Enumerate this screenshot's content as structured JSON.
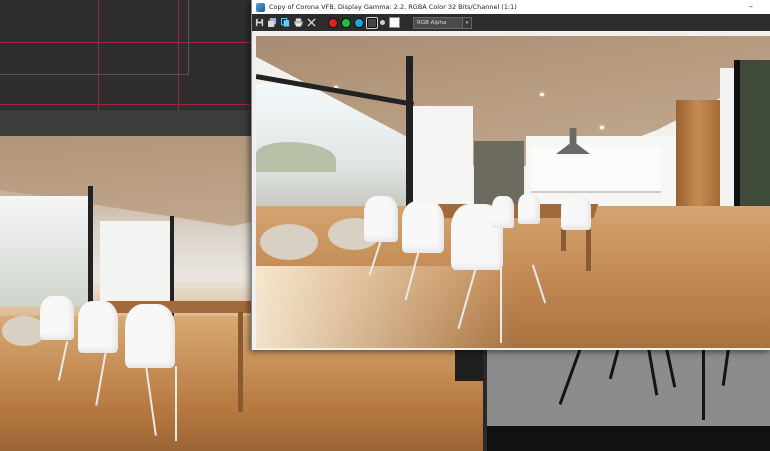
{
  "vfb": {
    "title": "Copy of Corona VFB, Display Gamma: 2.2, RGBA Color 32 Bits/Channel (1:1)",
    "minimize_glyph": "–",
    "toolbar": {
      "buttons": [
        {
          "name": "save-icon"
        },
        {
          "name": "save-all-icon"
        },
        {
          "name": "copy-icon"
        },
        {
          "name": "print-icon"
        },
        {
          "name": "clear-icon"
        }
      ],
      "channels": [
        {
          "name": "red-channel",
          "color": "#e02020"
        },
        {
          "name": "green-channel",
          "color": "#20c040"
        },
        {
          "name": "blue-channel",
          "color": "#20a0e0"
        },
        {
          "name": "alpha-channel",
          "color": "#444444"
        },
        {
          "name": "mono-channel",
          "color": "#d0d0d0"
        }
      ],
      "background_swatch_color": "#ffffff",
      "channel_select": {
        "selected": "RGB Alpha",
        "arrow": "▾"
      }
    }
  },
  "colors": {
    "toolbar_bg": "#2c2c2c",
    "viewport_bg": "#2e2e2e",
    "grid_line": "#a0283c"
  }
}
